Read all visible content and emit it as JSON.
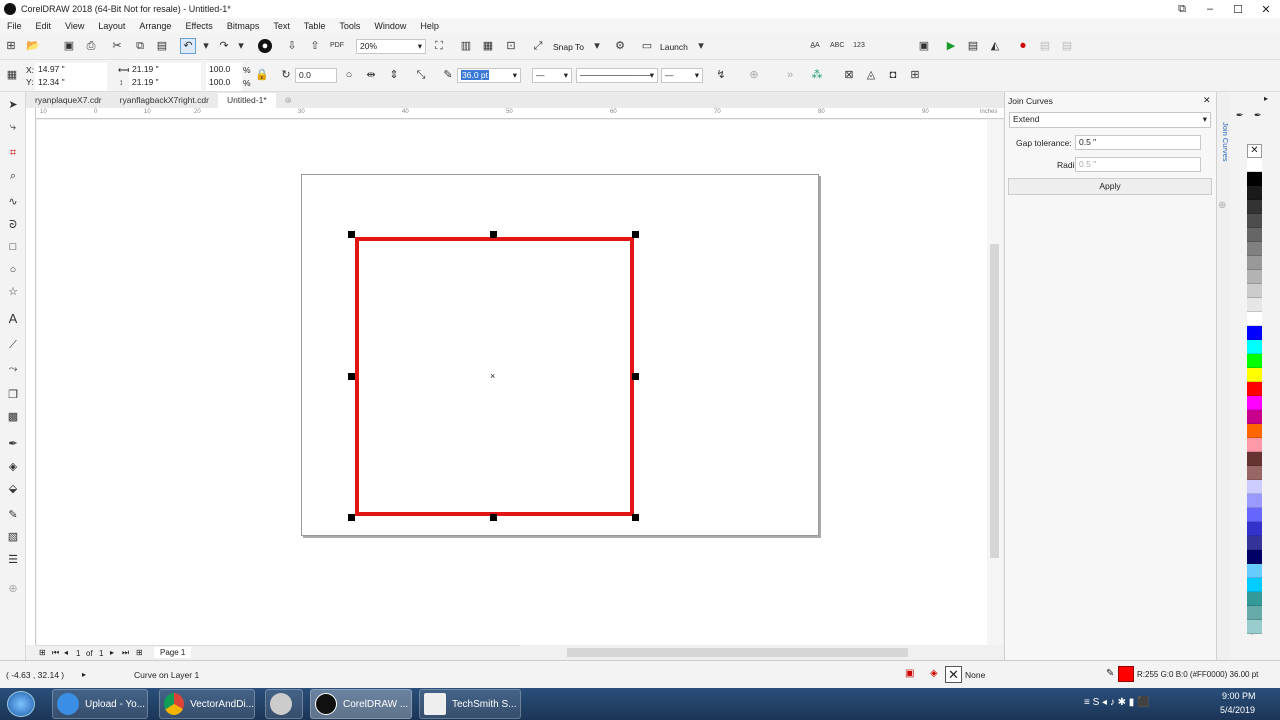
{
  "window": {
    "title": "CorelDRAW 2018 (64-Bit Not for resale) - Untitled-1*"
  },
  "menu": [
    "File",
    "Edit",
    "View",
    "Layout",
    "Arrange",
    "Effects",
    "Bitmaps",
    "Text",
    "Table",
    "Tools",
    "Window",
    "Help"
  ],
  "toolbar": {
    "zoom": "20%",
    "snap_to": "Snap To",
    "launch": "Launch"
  },
  "property_bar": {
    "x": "14.97 \"",
    "y": "12.34 \"",
    "width": "21.19 \"",
    "height": "21.19 \"",
    "scale_w": "100.0",
    "scale_h": "100.0",
    "pct": "%",
    "angle": "0.0",
    "outline_width": "36.0 pt"
  },
  "tabs": [
    "ryanplaqueX7.cdr",
    "ryanflagbackX7right.cdr",
    "Untitled-1*"
  ],
  "ruler": {
    "unit": "inches",
    "labels": [
      "10",
      "0",
      "10",
      "20",
      "30",
      "40",
      "50",
      "60",
      "70",
      "80",
      "90",
      "100"
    ]
  },
  "page_nav": {
    "current": "1",
    "of": "of",
    "total": "1",
    "page_tab": "Page 1"
  },
  "docker": {
    "title": "Join Curves",
    "mode": "Extend",
    "gap_label": "Gap tolerance:",
    "gap_value": "0.5 \"",
    "radius_label": "Radius:",
    "radius_value": "0.5 \"",
    "apply": "Apply",
    "side_tab": "Join Curves"
  },
  "status": {
    "coords": "( -4.63 , 32.14 )",
    "info": "Curve on Layer 1",
    "fill": "None",
    "outline": "R:255 G:0 B:0 (#FF0000)  36.00 pt"
  },
  "palette": [
    "#ffffff",
    "#000000",
    "#1a1a1a",
    "#333333",
    "#4d4d4d",
    "#666666",
    "#808080",
    "#999999",
    "#b3b3b3",
    "#cccccc",
    "#e6e6e6",
    "#ffffff",
    "#0000ff",
    "#00ffff",
    "#00ff00",
    "#ffff00",
    "#ff0000",
    "#ff00ff",
    "#c8008c",
    "#ff6600",
    "#ff99aa",
    "#663333",
    "#996666",
    "#ccccff",
    "#9999ff",
    "#6666ff",
    "#3333cc",
    "#333399",
    "#000066",
    "#66ccff",
    "#00ccff",
    "#339999",
    "#66aaaa",
    "#99cccc"
  ],
  "taskbar": {
    "items": [
      "Upload - Yo...",
      "VectorAndDi...",
      "",
      "CorelDRAW ...",
      "TechSmith S..."
    ],
    "time": "9:00 PM",
    "date": "5/4/2019"
  }
}
